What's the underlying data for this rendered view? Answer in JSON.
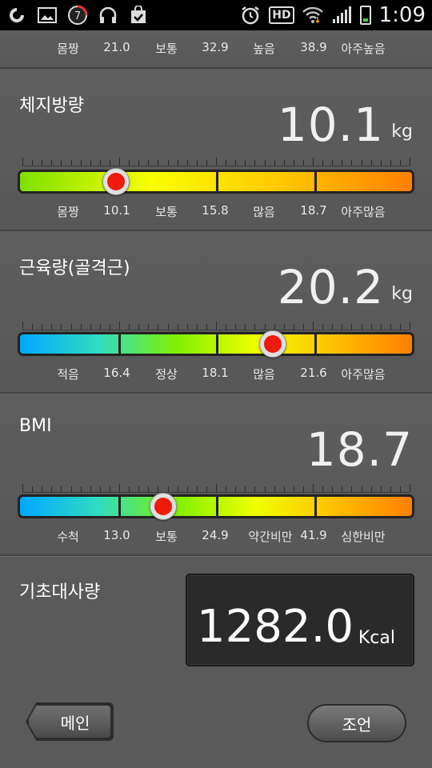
{
  "status_bar": {
    "time": "1:09",
    "notification_count": "7",
    "hd_label": "HD"
  },
  "top_scale": {
    "labels": [
      "몸짱",
      "21.0",
      "보통",
      "32.9",
      "높음",
      "38.9",
      "아주높음"
    ]
  },
  "body_fat": {
    "title": "체지방량",
    "value": "10.1",
    "unit": "kg",
    "knob_fraction": 0.245,
    "colors": [
      "#7de000",
      "#f8ff00",
      "#ffc800",
      "#ff8000"
    ],
    "labels": [
      "몸짱",
      "10.1",
      "보통",
      "15.8",
      "많음",
      "18.7",
      "아주많음"
    ]
  },
  "muscle": {
    "title": "근육량(골격근)",
    "value": "20.2",
    "unit": "kg",
    "knob_fraction": 0.645,
    "colors": [
      "#00a8ff",
      "#30dcc0",
      "#80f000",
      "#f0ff00",
      "#ffc000",
      "#ff8000"
    ],
    "labels": [
      "적음",
      "16.4",
      "정상",
      "18.1",
      "많음",
      "21.6",
      "아주많음"
    ]
  },
  "bmi": {
    "title": "BMI",
    "value": "18.7",
    "knob_fraction": 0.365,
    "colors": [
      "#00a8ff",
      "#30dcc0",
      "#80f000",
      "#f0ff00",
      "#ffc000",
      "#ff8000"
    ],
    "labels": [
      "수척",
      "13.0",
      "보통",
      "24.9",
      "약간비만",
      "41.9",
      "심한비만"
    ]
  },
  "bmr": {
    "title": "기초대사량",
    "value": "1282.0",
    "unit": "Kcal"
  },
  "buttons": {
    "main": "메인",
    "advice": "조언"
  }
}
